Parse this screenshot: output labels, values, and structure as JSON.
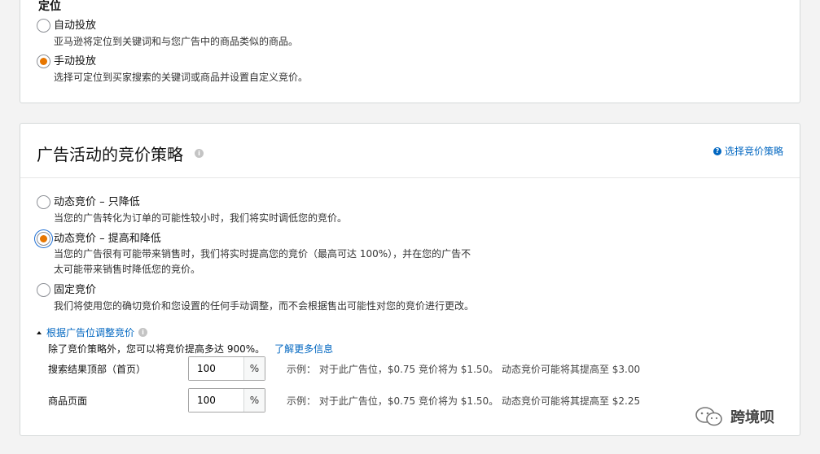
{
  "targeting": {
    "section_label": "定位",
    "options": [
      {
        "label": "自动投放",
        "desc": "亚马逊将定位到关键词和与您广告中的商品类似的商品。",
        "checked": false
      },
      {
        "label": "手动投放",
        "desc": "选择可定位到买家搜索的关键词或商品并设置自定义竞价。",
        "checked": true
      }
    ]
  },
  "bidding": {
    "title": "广告活动的竞价策略",
    "help_link": "选择竞价策略",
    "options": [
      {
        "label": "动态竞价 – 只降低",
        "desc": [
          "当您的广告转化为订单的可能性较小时，我们将实时调低您的竞价。"
        ],
        "checked": false
      },
      {
        "label": "动态竞价 – 提高和降低",
        "desc": [
          "当您的广告很有可能带来销售时，我们将实时提高您的竞价（最高可达 100%），并在您的广告不",
          "太可能带来销售时降低您的竞价。"
        ],
        "checked": true
      },
      {
        "label": "固定竞价",
        "desc": [
          "我们将使用您的确切竞价和您设置的任何手动调整，而不会根据售出可能性对您的竞价进行更改。"
        ],
        "checked": false
      }
    ],
    "adjust": {
      "toggle_label": "根据广告位调整竞价",
      "desc": "除了竞价策略外，您可以将竞价提高多达 900%。",
      "learn_more": "了解更多信息",
      "rows": [
        {
          "label": "搜索结果顶部（首页）",
          "value": "100",
          "unit": "%",
          "example": "示例： 对于此广告位，$0.75 竞价将为 $1.50。 动态竞价可能将其提高至 $3.00"
        },
        {
          "label": "商品页面",
          "value": "100",
          "unit": "%",
          "example": "示例： 对于此广告位，$0.75 竞价将为 $1.50。 动态竞价可能将其提高至 $2.25"
        }
      ]
    }
  },
  "watermark": {
    "text": "跨境呗",
    "icon": "wechat-icon"
  },
  "colors": {
    "accent": "#e77600",
    "link": "#0066c0",
    "focus": "#1f6fd3"
  }
}
